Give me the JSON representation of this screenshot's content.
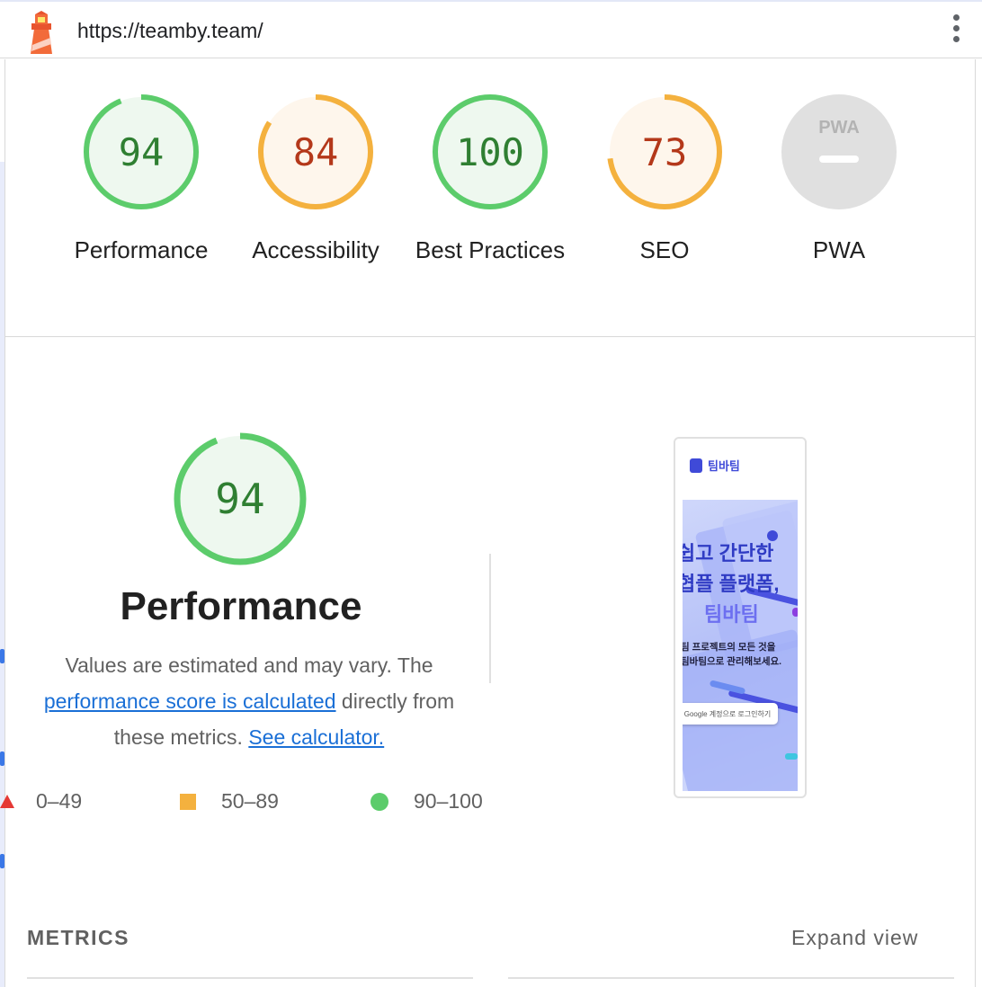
{
  "header": {
    "url": "https://teamby.team/",
    "menu_icon": "kebab-menu-icon"
  },
  "categories": [
    {
      "label": "Performance",
      "score": "94",
      "status": "pass"
    },
    {
      "label": "Accessibility",
      "score": "84",
      "status": "average"
    },
    {
      "label": "Best Practices",
      "score": "100",
      "status": "pass"
    },
    {
      "label": "SEO",
      "score": "73",
      "status": "average"
    },
    {
      "label": "PWA",
      "score": "",
      "badge_text": "PWA",
      "status": "na"
    }
  ],
  "colors": {
    "pass": "#0cce6b",
    "pass_ring": "#5ccc6b",
    "pass_fill": "#eef8ef",
    "pass_text": "#2f7f32",
    "average": "#f4b13e",
    "average_fill": "#fef6ec",
    "average_text": "#b4381a",
    "fail": "#e53935",
    "na_fill": "#e0e0e0",
    "link": "#1a6fd6"
  },
  "performance": {
    "score": "94",
    "title": "Performance",
    "desc_part1": "Values are estimated and may vary. The ",
    "desc_link1": "performance score is calculated",
    "desc_part2": " directly from these metrics.",
    "desc_link2": "See calculator."
  },
  "legend": [
    {
      "range": "0–49",
      "shape": "triangle"
    },
    {
      "range": "50–89",
      "shape": "square"
    },
    {
      "range": "90–100",
      "shape": "circle"
    }
  ],
  "screenshot": {
    "brand": "팀바팀",
    "headline1": "쉽고 간단한",
    "headline2": "협플 플랫폼,",
    "headline3": "팀바팀",
    "sub1": "팀 프로젝트의 모든 것을",
    "sub2": "팀바팀으로 관리해보세요.",
    "button": "Google 계정으로 로그인하기"
  },
  "metrics": {
    "title": "METRICS",
    "expand_label": "Expand view"
  }
}
